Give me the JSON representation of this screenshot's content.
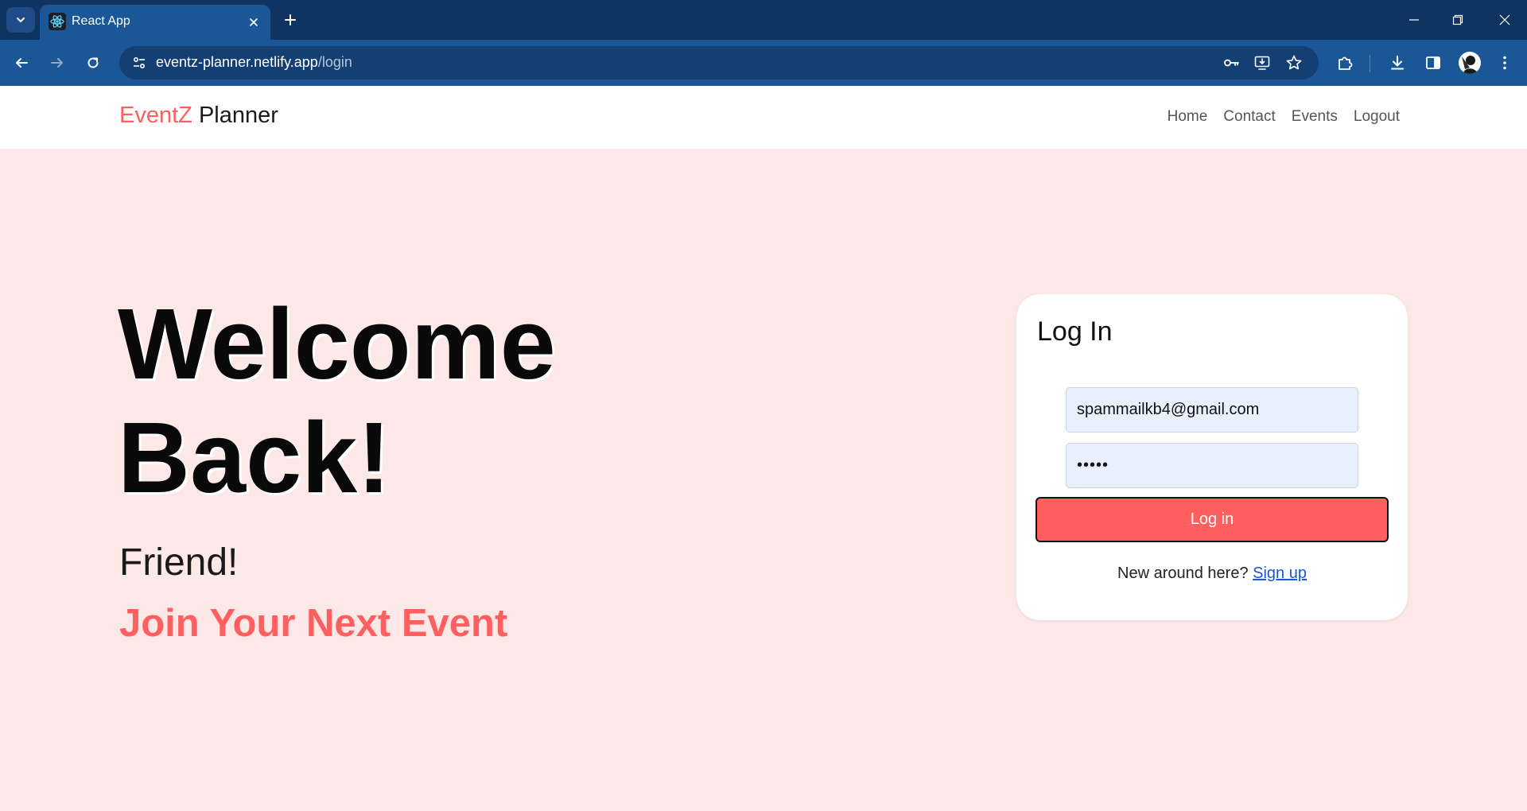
{
  "browser": {
    "tab_title": "React App",
    "url_host": "eventz-planner.netlify.app",
    "url_path": "/login"
  },
  "icons": {
    "tab_search": "chevron-down-icon",
    "favicon": "react-icon",
    "tab_close": "close-icon",
    "new_tab": "plus-icon",
    "back": "arrow-left-icon",
    "forward": "arrow-right-icon",
    "reload": "reload-icon",
    "site_info": "tune-icon",
    "password": "key-icon",
    "install": "install-app-icon",
    "bookmark": "star-icon",
    "extensions": "puzzle-icon",
    "downloads": "download-icon",
    "side_panel": "side-panel-icon",
    "menu": "kebab-menu-icon"
  },
  "site": {
    "brand_part1": "EventZ",
    "brand_part2": "Planner",
    "nav": [
      "Home",
      "Contact",
      "Events",
      "Logout"
    ]
  },
  "hero": {
    "line1": "Welcome",
    "line2": "Back!",
    "sub": "Friend!",
    "tagline": "Join Your Next Event"
  },
  "login": {
    "title": "Log In",
    "email_value": "spammailkb4@gmail.com",
    "password_value": "•••••",
    "button_label": "Log in",
    "prompt": "New around here?",
    "signup_label": "Sign up"
  },
  "colors": {
    "accent": "#ff5f5f",
    "page_bg": "#fde8e8",
    "chrome_dark": "#0f3461",
    "chrome": "#1b5797",
    "link": "#1a55d6"
  }
}
